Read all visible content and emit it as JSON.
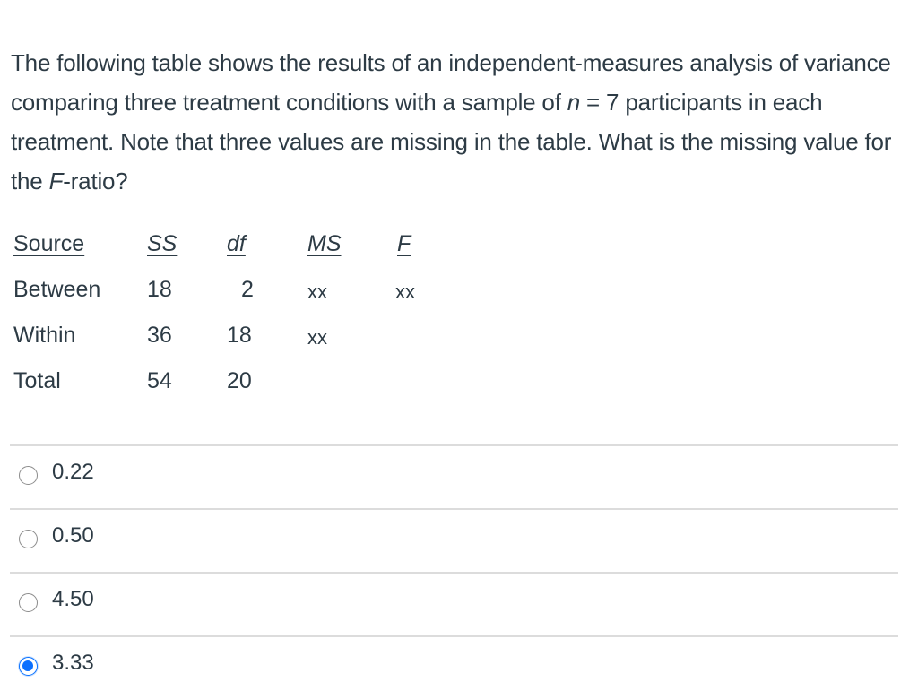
{
  "question": {
    "part1": "The following table shows the results of an independent-measures analysis of variance comparing three treatment conditions with a sample of ",
    "n_var": "n",
    "part2": " = 7 participants in each treatment. Note that three values are missing in the table. What is the missing value for the ",
    "f_var": "F",
    "part3": "-ratio?"
  },
  "anova_table": {
    "headers": [
      "Source",
      "SS",
      "df",
      "MS",
      "F"
    ],
    "rows": [
      {
        "source": "Between",
        "ss": "18",
        "df": "2",
        "ms": "xx",
        "f": "xx"
      },
      {
        "source": "Within",
        "ss": "36",
        "df": "18",
        "ms": "xx",
        "f": ""
      },
      {
        "source": "Total",
        "ss": "54",
        "df": "20",
        "ms": "",
        "f": ""
      }
    ]
  },
  "answers": {
    "selected_index": 3,
    "options": [
      {
        "label": "0.22",
        "selected": false
      },
      {
        "label": "0.50",
        "selected": false
      },
      {
        "label": "4.50",
        "selected": false
      },
      {
        "label": "3.33",
        "selected": true
      }
    ]
  },
  "colors": {
    "text": "#2d3b45",
    "radio_selected": "#0a6fff",
    "divider": "#dcdcdc"
  }
}
